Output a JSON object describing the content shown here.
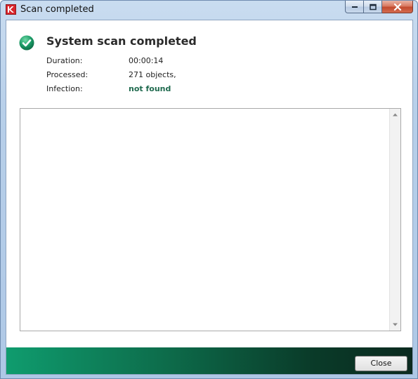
{
  "window": {
    "title": "Scan completed",
    "controls": [
      "minimize",
      "maximize",
      "close"
    ]
  },
  "summary": {
    "status_icon": "checkmark-icon",
    "heading": "System scan completed",
    "rows": [
      {
        "label": "Duration:",
        "value": "00:00:14"
      },
      {
        "label": "Processed:",
        "value": "271 objects,"
      },
      {
        "label": "Infection:",
        "value": "not found"
      }
    ]
  },
  "results_pane": {
    "items": []
  },
  "footer": {
    "close_label": "Close"
  },
  "colors": {
    "accent_green": "#1f6a4e",
    "footer_gradient_start": "#0f9c6e",
    "footer_gradient_end": "#0b2a1f",
    "brand_red": "#d9252c"
  }
}
